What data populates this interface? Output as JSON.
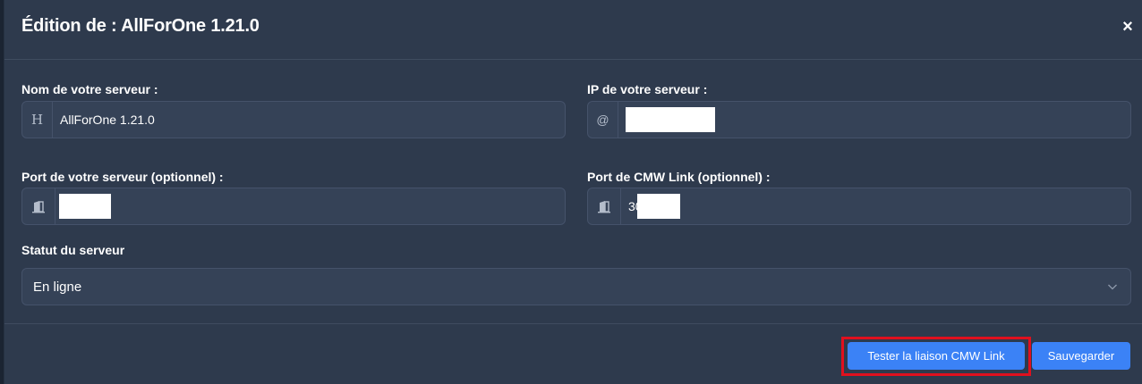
{
  "modal": {
    "title": "Édition de : AllForOne 1.21.0",
    "close_label": "×"
  },
  "fields": {
    "server_name": {
      "label": "Nom de votre serveur :",
      "addon": "H",
      "value": "AllForOne 1.21.0"
    },
    "server_ip": {
      "label": "IP de votre serveur :",
      "addon": "@",
      "value": ""
    },
    "server_port": {
      "label": "Port de votre serveur (optionnel) :",
      "addon": "door-icon",
      "value": ""
    },
    "cmw_port": {
      "label": "Port de CMW Link (optionnel) :",
      "addon": "door-icon",
      "value": "30"
    },
    "status": {
      "label": "Statut du serveur",
      "value": "En ligne"
    }
  },
  "footer": {
    "test_button": "Tester la liaison CMW Link",
    "save_button": "Sauvegarder"
  },
  "colors": {
    "modal_bg": "#2e3a4d",
    "input_bg": "#354257",
    "primary": "#3b82f6",
    "highlight": "#e0101e"
  }
}
